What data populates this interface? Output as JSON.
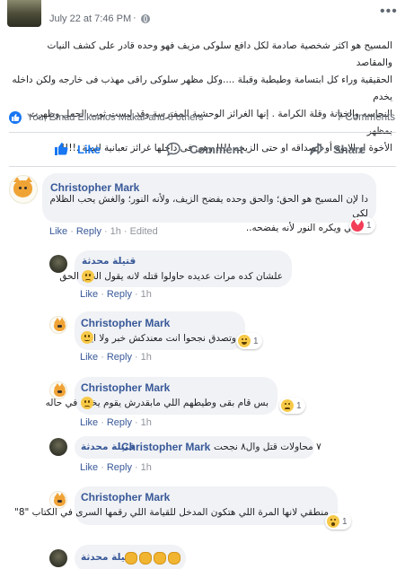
{
  "post": {
    "timestamp": "July 22 at 7:46 PM",
    "dot": "·",
    "menu": "•••",
    "lines": [
      "المسيح هو اكثر شخصية صادمة لكل دافع سلوكى مزيف فهو وحده قادر على كشف النيات والمقاصد",
      "الحقيقية وراء كل ابتسامة وطيطبة وقبلة ....وكل مظهر سلوكى راقى مهذب فى خارجه ولكن داخله يخدم",
      "النجاسه والخيانة وقلة الكرامة . إنها الغرائز الوحشية المفترسة وقد لبست ثوب الحمل وظهرت بمظهر",
      "الأخوة او الابوة أو الصداقه او حتى الزيجه !!!! وهى فى داخلها غرائز تعبانية لئيمة .!!!!"
    ],
    "reactions_text": "You, Emad Elkomos Makar and 6 others",
    "comments_count": "7 Comments"
  },
  "actions": {
    "like": "Like",
    "comment": "Comment",
    "share": "Share"
  },
  "comments": [
    {
      "author": "Christopher Mark",
      "text_lines": [
        "دا لإن المسيح هو الحق؛ والحق وحده يفضح الزيف، ولأنه النور؛ والغش يحب الظلام لكي",
        "يتخفّي ويكره النور لأنه يفضحه.."
      ],
      "reaction_count": "1",
      "like": "Like",
      "reply": "Reply",
      "age": "1h",
      "edited": "Edited"
    },
    {
      "author": "قتيلة محدثة",
      "text": "علشان كده مرات عديده حاولوا قتله لانه يقول الحق الحق",
      "like": "Like",
      "reply": "Reply",
      "age": "1h"
    },
    {
      "author": "Christopher Mark",
      "text": "وتصدق نجحوا انت معندكش خبر ولا ايه؟",
      "reaction_count": "1",
      "like": "Like",
      "reply": "Reply",
      "age": "1h"
    },
    {
      "author": "Christopher Mark",
      "text": "بس قام بقى وطيطهم اللي مابقدرش يقوم يخليه في حاله",
      "reaction_count": "1",
      "like": "Like",
      "reply": "Reply",
      "age": "1h"
    },
    {
      "author": "قتيلة محدثة",
      "text_prefix": "٧ محاولات قتل وال٨ نجحت",
      "mention": "Christopher Mark",
      "like": "Like",
      "reply": "Reply",
      "age": "1h"
    },
    {
      "author": "Christopher Mark",
      "text": "منطقي لانها المرة اللي هتكون المدخل للقيامة اللي رقمها السرى في الكتاب \"8\"",
      "reaction_count": "1",
      "like": "Like",
      "reply": "Reply",
      "age": "1h"
    },
    {
      "author": "قتيلة محدثة"
    }
  ]
}
